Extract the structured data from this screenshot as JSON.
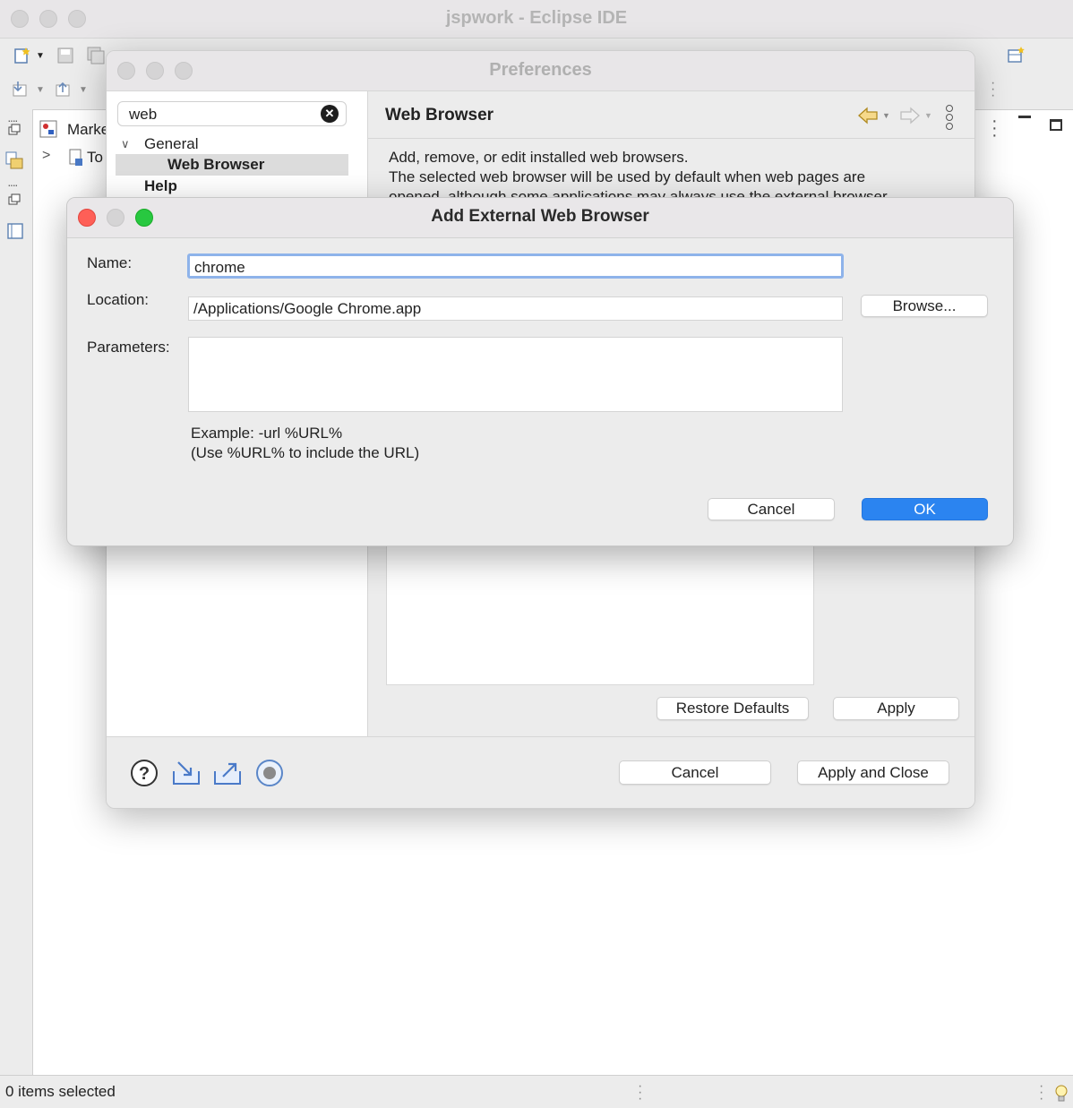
{
  "main_window": {
    "title": "jspwork - Eclipse IDE",
    "views": {
      "markers_label": "Marke",
      "tree_item": "To"
    },
    "status_text": "0 items selected"
  },
  "preferences": {
    "title": "Preferences",
    "search_value": "web",
    "tree": {
      "general": "General",
      "web_browser": "Web Browser",
      "help": "Help"
    },
    "page_title": "Web Browser",
    "description_line1": "Add, remove, or edit installed web browsers.",
    "description_line2": "The selected web browser will be used by default when web pages are",
    "description_line3": "opened, although some applications may always use the external browser.",
    "restore_defaults": "Restore Defaults",
    "apply": "Apply",
    "cancel": "Cancel",
    "apply_close": "Apply and Close"
  },
  "add_browser_dialog": {
    "title": "Add External Web Browser",
    "name_label": "Name:",
    "name_value": "chrome",
    "location_label": "Location:",
    "location_value": "/Applications/Google Chrome.app",
    "browse": "Browse...",
    "parameters_label": "Parameters:",
    "parameters_value": "",
    "example_line1": "Example: -url %URL%",
    "example_line2": "(Use %URL% to include the URL)",
    "cancel": "Cancel",
    "ok": "OK"
  },
  "colors": {
    "ok_button": "#2b84f0",
    "close_red": "#fe5f57",
    "minimize_yellow": "#d5d4d5",
    "zoom_green": "#28c840",
    "focus_ring": "#8eb3ea"
  }
}
